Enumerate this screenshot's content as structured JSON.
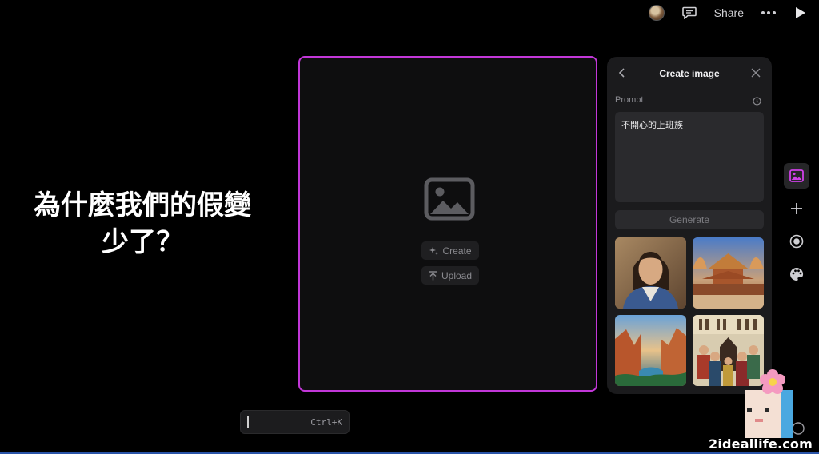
{
  "topbar": {
    "share_label": "Share",
    "icons": [
      "avatar",
      "comment-icon",
      "more-icon",
      "play-icon"
    ]
  },
  "slide": {
    "line1": "為什麼我們的假變",
    "line2": "少了？"
  },
  "canvas": {
    "create_label": "Create",
    "upload_label": "Upload",
    "accent_color": "#c237d8"
  },
  "command": {
    "shortcut": "Ctrl+K"
  },
  "panel": {
    "title": "Create image",
    "prompt_label": "Prompt",
    "prompt_value": "不開心的上班族",
    "generate_label": "Generate",
    "thumbnails": [
      "portrait-thumbnail",
      "temple-thumbnail",
      "canyon-thumbnail",
      "crowd-thumbnail"
    ]
  },
  "rail": {
    "icons": [
      "image-icon",
      "plus-icon",
      "record-icon",
      "palette-icon"
    ]
  },
  "watermark": {
    "text": "2ideallife.com"
  }
}
